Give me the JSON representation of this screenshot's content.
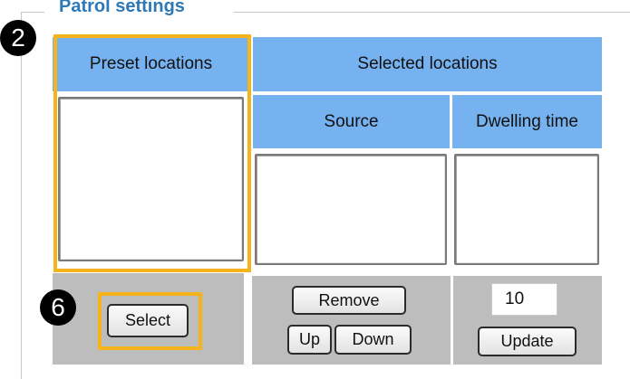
{
  "legend": "Patrol settings",
  "headers": {
    "preset_locations": "Preset locations",
    "selected_locations": "Selected locations",
    "source": "Source",
    "dwelling_time": "Dwelling time"
  },
  "badges": {
    "step_2": "2",
    "step_6": "6"
  },
  "buttons": {
    "select": "Select",
    "remove": "Remove",
    "up": "Up",
    "down": "Down",
    "update": "Update"
  },
  "dwelling_time_value": "10",
  "colors": {
    "header_blue": "#76b2f0",
    "legend_blue": "#2d79b7",
    "highlight": "#f4b41a",
    "cell_gray": "#bdbdbd"
  }
}
